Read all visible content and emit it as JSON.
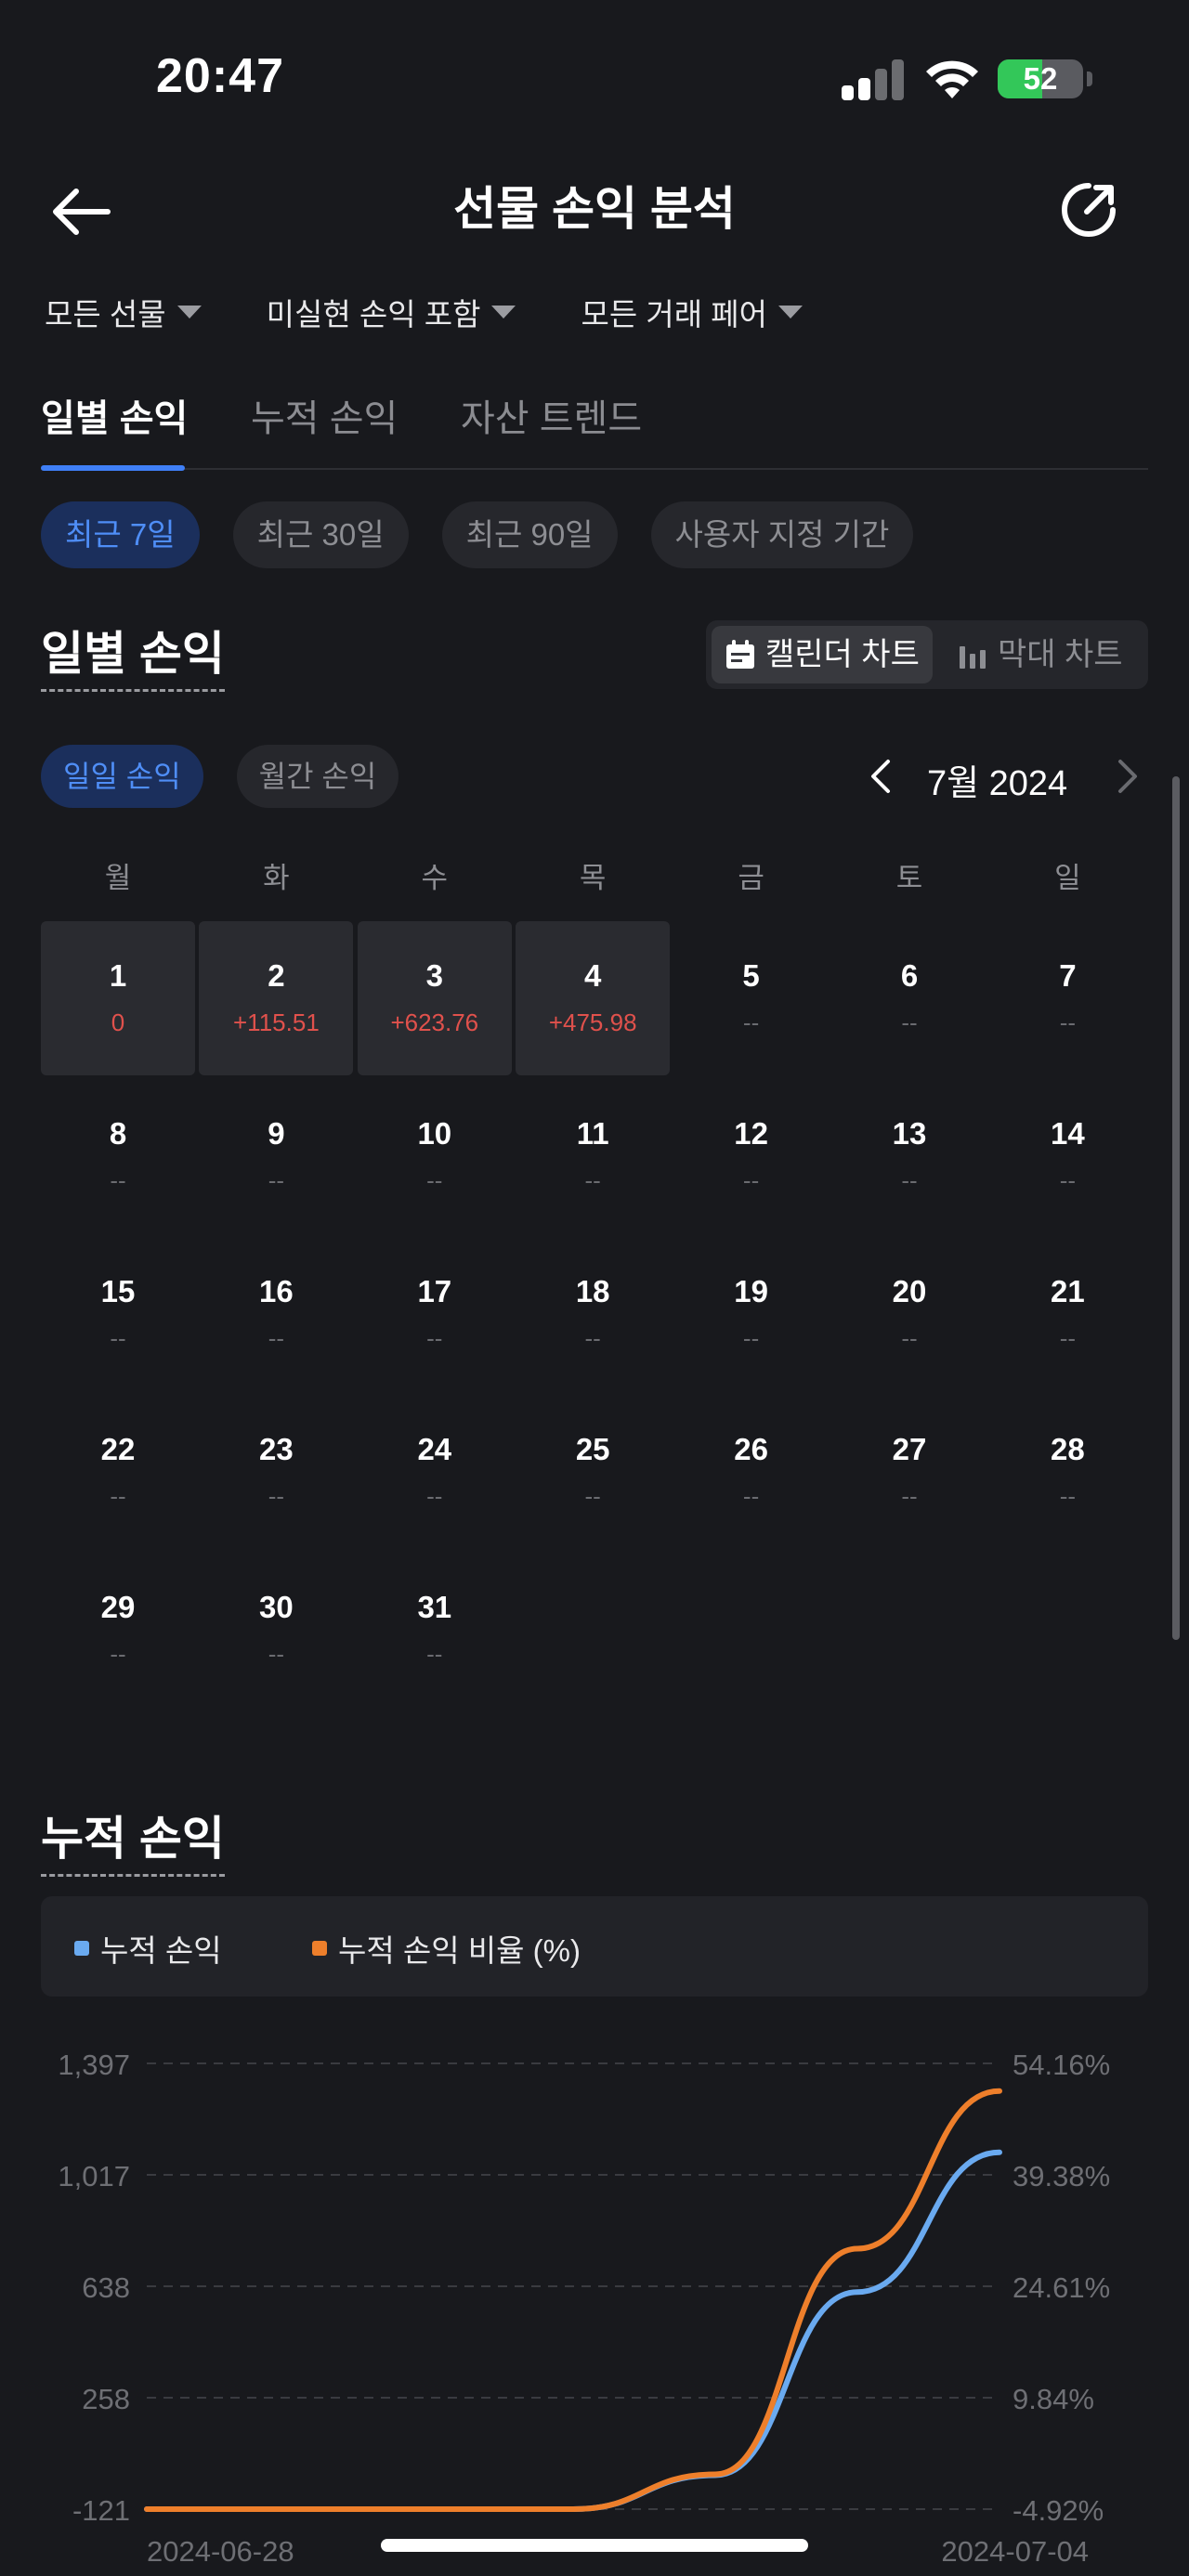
{
  "status_bar": {
    "time": "20:47",
    "battery": "52",
    "battery_level": 0.52
  },
  "header": {
    "title": "선물 손익 분석"
  },
  "filters": [
    {
      "label": "모든 선물"
    },
    {
      "label": "미실현 손익 포함"
    },
    {
      "label": "모든 거래 페어"
    }
  ],
  "tabs": [
    {
      "label": "일별 손익",
      "active": true
    },
    {
      "label": "누적 손익",
      "active": false
    },
    {
      "label": "자산 트렌드",
      "active": false
    }
  ],
  "periods": [
    {
      "label": "최근 7일",
      "active": true
    },
    {
      "label": "최근 30일",
      "active": false
    },
    {
      "label": "최근 90일",
      "active": false
    },
    {
      "label": "사용자 지정 기간",
      "active": false
    }
  ],
  "daily_section": {
    "title": "일별 손익",
    "toggle": [
      {
        "label": "캘린더 차트",
        "icon": "calendar-icon",
        "active": true
      },
      {
        "label": "막대 차트",
        "icon": "bar-chart-icon",
        "active": false
      }
    ],
    "sub_pills": [
      {
        "label": "일일 손익",
        "active": true
      },
      {
        "label": "월간 손익",
        "active": false
      }
    ],
    "month": "7월 2024"
  },
  "calendar": {
    "weekdays": [
      "월",
      "화",
      "수",
      "목",
      "금",
      "토",
      "일"
    ],
    "first_weekday_index": 0,
    "days": [
      {
        "day": "1",
        "value": "0",
        "filled": true,
        "positive": true
      },
      {
        "day": "2",
        "value": "+115.51",
        "filled": true,
        "positive": true
      },
      {
        "day": "3",
        "value": "+623.76",
        "filled": true,
        "positive": true
      },
      {
        "day": "4",
        "value": "+475.98",
        "filled": true,
        "positive": true
      },
      {
        "day": "5",
        "value": "--"
      },
      {
        "day": "6",
        "value": "--"
      },
      {
        "day": "7",
        "value": "--"
      },
      {
        "day": "8",
        "value": "--"
      },
      {
        "day": "9",
        "value": "--"
      },
      {
        "day": "10",
        "value": "--"
      },
      {
        "day": "11",
        "value": "--"
      },
      {
        "day": "12",
        "value": "--"
      },
      {
        "day": "13",
        "value": "--"
      },
      {
        "day": "14",
        "value": "--"
      },
      {
        "day": "15",
        "value": "--"
      },
      {
        "day": "16",
        "value": "--"
      },
      {
        "day": "17",
        "value": "--"
      },
      {
        "day": "18",
        "value": "--"
      },
      {
        "day": "19",
        "value": "--"
      },
      {
        "day": "20",
        "value": "--"
      },
      {
        "day": "21",
        "value": "--"
      },
      {
        "day": "22",
        "value": "--"
      },
      {
        "day": "23",
        "value": "--"
      },
      {
        "day": "24",
        "value": "--"
      },
      {
        "day": "25",
        "value": "--"
      },
      {
        "day": "26",
        "value": "--"
      },
      {
        "day": "27",
        "value": "--"
      },
      {
        "day": "28",
        "value": "--"
      },
      {
        "day": "29",
        "value": "--"
      },
      {
        "day": "30",
        "value": "--"
      },
      {
        "day": "31",
        "value": "--"
      }
    ]
  },
  "cumulative_section": {
    "title": "누적 손익"
  },
  "colors": {
    "accent": "#3f7ff6",
    "series_pnl": "#6aaaf0",
    "series_ratio": "#ee7f2b",
    "positive": "#e0514c"
  },
  "chart_data": {
    "type": "line",
    "x": [
      "2024-06-28",
      "2024-06-29",
      "2024-06-30",
      "2024-07-01",
      "2024-07-02",
      "2024-07-03",
      "2024-07-04"
    ],
    "x_tick_labels": [
      "2024-06-28",
      "2024-07-04"
    ],
    "series": [
      {
        "name": "누적 손익",
        "axis": "left",
        "color": "#6aaaf0",
        "values": [
          -121,
          -121,
          -121,
          -121,
          -5.49,
          618.27,
          1094.25
        ]
      },
      {
        "name": "누적 손익 비율 (%)",
        "axis": "right",
        "color": "#ee7f2b",
        "values": [
          -4.92,
          -4.92,
          -4.92,
          -4.92,
          -0.3,
          29.6,
          50.5
        ]
      }
    ],
    "y_left": {
      "ticks": [
        "1,397",
        "1,017",
        "638",
        "258",
        "-121"
      ],
      "ylim": [
        -121,
        1397
      ]
    },
    "y_right": {
      "ticks": [
        "54.16%",
        "39.38%",
        "24.61%",
        "9.84%",
        "-4.92%"
      ],
      "ylim": [
        -4.92,
        54.16
      ]
    },
    "grid": true,
    "legend": "top"
  }
}
